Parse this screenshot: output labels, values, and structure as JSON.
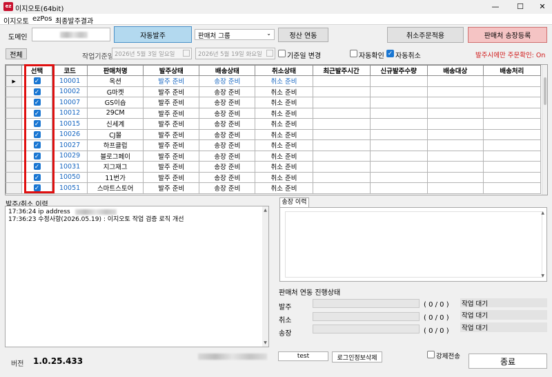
{
  "window": {
    "title": "이지오토(64bit)",
    "app_icon": "ez-logo-icon"
  },
  "menu": [
    "이지오토",
    "ezPos",
    "최종발주결과"
  ],
  "top": {
    "domain_label": "도메인",
    "auto_order_btn": "자동발주",
    "seller_group": "판매처 그룹",
    "settle_btn": "정산 연동",
    "cancel_order_btn": "취소주문적용",
    "invoice_btn": "판매처 송장등록",
    "all_btn": "전체",
    "date_label": "작업기준일",
    "date_from": "2026년  5월  3일 일요일",
    "date_to": "2026년  5월 19일 화요일",
    "base_change": "기준일 변경",
    "auto_confirm": "자동확인",
    "auto_cancel": "자동취소",
    "order_notice": "발주시에만 주문확인: On"
  },
  "grid": {
    "columns": [
      "선택",
      "코드",
      "판매처명",
      "발주상태",
      "배송상태",
      "취소상태",
      "최근발주시간",
      "신규발주수량",
      "배송대상",
      "배송처리"
    ],
    "rows": [
      {
        "code": "10001",
        "name": "옥션",
        "order": "발주 준비",
        "ship": "송장 준비",
        "cancel": "취소 준비"
      },
      {
        "code": "10002",
        "name": "G마켓",
        "order": "발주 준비",
        "ship": "송장 준비",
        "cancel": "취소 준비"
      },
      {
        "code": "10007",
        "name": "GS이숍",
        "order": "발주 준비",
        "ship": "송장 준비",
        "cancel": "취소 준비"
      },
      {
        "code": "10012",
        "name": "29CM",
        "order": "발주 준비",
        "ship": "송장 준비",
        "cancel": "취소 준비"
      },
      {
        "code": "10015",
        "name": "신세계",
        "order": "발주 준비",
        "ship": "송장 준비",
        "cancel": "취소 준비"
      },
      {
        "code": "10026",
        "name": "CJ몰",
        "order": "발주 준비",
        "ship": "송장 준비",
        "cancel": "취소 준비"
      },
      {
        "code": "10027",
        "name": "하프클럽",
        "order": "발주 준비",
        "ship": "송장 준비",
        "cancel": "취소 준비"
      },
      {
        "code": "10029",
        "name": "블로그페이",
        "order": "발주 준비",
        "ship": "송장 준비",
        "cancel": "취소 준비"
      },
      {
        "code": "10031",
        "name": "지그재그",
        "order": "발주 준비",
        "ship": "송장 준비",
        "cancel": "취소 준비"
      },
      {
        "code": "10050",
        "name": "11번가",
        "order": "발주 준비",
        "ship": "송장 준비",
        "cancel": "취소 준비"
      },
      {
        "code": "10051",
        "name": "스마트스토어",
        "order": "발주 준비",
        "ship": "송장 준비",
        "cancel": "취소 준비"
      }
    ]
  },
  "log": {
    "title": "발주/취소 이력",
    "lines": [
      "17:36:24 ip address",
      "17:36:23 수정사항(2026.05.19) : 이지오토 작업 검증 로직 개선"
    ]
  },
  "invoice_tab": "송장 이력",
  "progress": {
    "title": "판매처 연동 진행상태",
    "items": [
      {
        "label": "발주",
        "count": "( 0 / 0 )",
        "status": "작업 대기"
      },
      {
        "label": "취소",
        "count": "( 0 / 0 )",
        "status": "작업 대기"
      },
      {
        "label": "송장",
        "count": "( 0 / 0 )",
        "status": "작업 대기"
      }
    ]
  },
  "bottom": {
    "version_label": "버전",
    "version": "1.0.25.433",
    "test_btn": "test",
    "login_del_btn": "로그인정보삭제",
    "force_send": "강제전송",
    "exit_btn": "종료"
  },
  "colors": {
    "accent_blue": "#1565c0",
    "alert_red": "#e01010",
    "active_btn": "#b3d9ef",
    "invoice_btn_bg": "#f5c4c4"
  }
}
